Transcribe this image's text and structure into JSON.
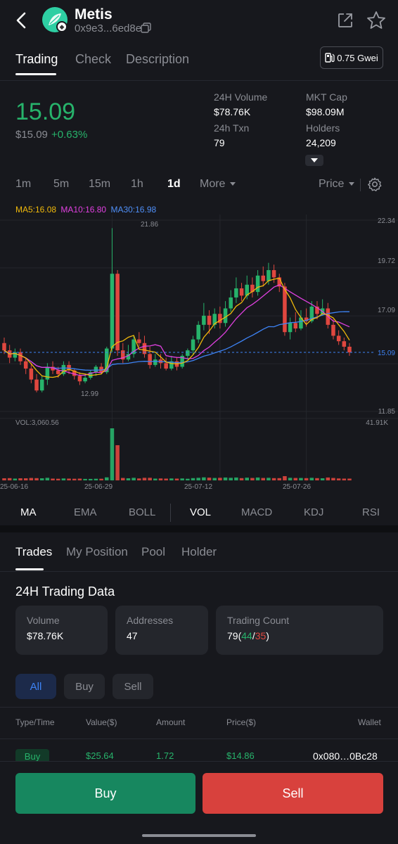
{
  "header": {
    "coin_name": "Metis",
    "address": "0x9e3...6ed8e",
    "icons": [
      "back-arrow-icon",
      "coin-logo",
      "ethereum-icon",
      "copy-icon",
      "share-icon",
      "star-icon"
    ]
  },
  "tabs": [
    {
      "label": "Trading",
      "active": true
    },
    {
      "label": "Check",
      "active": false
    },
    {
      "label": "Description",
      "active": false
    }
  ],
  "gas": {
    "value": "0.75 Gwei",
    "icon": "gas-pump-icon"
  },
  "price": {
    "main": "15.09",
    "usd": "$15.09",
    "change": "+0.63%"
  },
  "stats": {
    "volume_label": "24H Volume",
    "volume_value": "$78.76K",
    "mktcap_label": "MKT Cap",
    "mktcap_value": "$98.09M",
    "txn_label": "24h Txn",
    "txn_value": "79",
    "holders_label": "Holders",
    "holders_value": "24,209"
  },
  "timeframes": [
    {
      "label": "1m",
      "active": false
    },
    {
      "label": "5m",
      "active": false
    },
    {
      "label": "15m",
      "active": false
    },
    {
      "label": "1h",
      "active": false
    },
    {
      "label": "1d",
      "active": true
    },
    {
      "label": "More",
      "active": false
    }
  ],
  "price_dropdown": "Price",
  "ma_legend": {
    "ma5": "MA5:16.08",
    "ma10": "MA10:16.80",
    "ma30": "MA30:16.98",
    "colors": {
      "ma5": "#f0b90b",
      "ma10": "#e040e0",
      "ma30": "#3d83f5"
    }
  },
  "chart_data": {
    "type": "candlestick",
    "y_ticks": [
      "22.34",
      "19.72",
      "17.09",
      "11.85"
    ],
    "current_price_tag": "15.09",
    "high_label": "21.86",
    "low_label": "12.99",
    "volume_label": "VOL:3,060.56",
    "volume_max_label": "41.91K",
    "x_ticks": [
      "25-06-16",
      "25-06-29",
      "25-07-12",
      "25-07-26"
    ],
    "candles": [
      [
        15.6,
        15.2,
        15.9,
        15.0
      ],
      [
        15.2,
        14.8,
        15.5,
        14.5
      ],
      [
        14.8,
        15.1,
        15.3,
        14.6
      ],
      [
        15.1,
        14.6,
        15.3,
        14.4
      ],
      [
        14.6,
        14.2,
        14.8,
        13.9
      ],
      [
        14.2,
        13.6,
        14.5,
        13.4
      ],
      [
        13.6,
        13.0,
        13.9,
        12.9
      ],
      [
        13.0,
        13.6,
        13.8,
        12.9
      ],
      [
        13.6,
        14.3,
        14.5,
        13.3
      ],
      [
        14.3,
        14.1,
        14.6,
        13.9
      ],
      [
        14.1,
        13.9,
        14.3,
        13.7
      ],
      [
        13.9,
        14.4,
        14.6,
        13.8
      ],
      [
        14.4,
        14.1,
        14.6,
        13.9
      ],
      [
        14.1,
        13.8,
        14.2,
        13.6
      ],
      [
        13.8,
        13.5,
        14.0,
        13.3
      ],
      [
        13.5,
        13.7,
        13.9,
        13.4
      ],
      [
        13.7,
        14.0,
        14.1,
        13.6
      ],
      [
        14.0,
        14.3,
        14.4,
        13.8
      ],
      [
        14.3,
        14.0,
        14.5,
        13.9
      ],
      [
        14.0,
        15.3,
        15.4,
        13.9
      ],
      [
        15.3,
        19.4,
        21.9,
        15.1
      ],
      [
        19.4,
        15.2,
        19.6,
        14.9
      ],
      [
        15.2,
        14.7,
        15.6,
        14.5
      ],
      [
        14.7,
        15.0,
        15.5,
        14.6
      ],
      [
        15.0,
        15.8,
        16.0,
        14.8
      ],
      [
        15.8,
        15.6,
        16.2,
        15.4
      ],
      [
        15.6,
        15.0,
        16.0,
        14.8
      ],
      [
        15.0,
        14.4,
        15.4,
        14.2
      ],
      [
        14.4,
        14.7,
        15.0,
        14.3
      ],
      [
        14.7,
        14.5,
        15.0,
        14.2
      ],
      [
        14.5,
        14.2,
        14.8,
        14.1
      ],
      [
        14.2,
        14.6,
        14.9,
        14.1
      ],
      [
        14.6,
        14.3,
        14.8,
        14.1
      ],
      [
        14.3,
        14.9,
        15.0,
        14.2
      ],
      [
        14.9,
        15.2,
        15.3,
        14.7
      ],
      [
        15.2,
        15.8,
        16.0,
        15.0
      ],
      [
        15.8,
        16.6,
        16.8,
        15.6
      ],
      [
        16.6,
        17.1,
        17.8,
        16.3
      ],
      [
        17.1,
        16.6,
        17.4,
        16.1
      ],
      [
        16.6,
        17.2,
        17.5,
        16.4
      ],
      [
        17.2,
        16.7,
        17.6,
        16.4
      ],
      [
        16.7,
        17.5,
        17.9,
        16.5
      ],
      [
        17.5,
        18.1,
        18.5,
        17.3
      ],
      [
        18.1,
        18.6,
        19.2,
        17.8
      ],
      [
        18.6,
        18.2,
        18.9,
        17.9
      ],
      [
        18.2,
        18.8,
        19.3,
        18.0
      ],
      [
        18.8,
        18.4,
        19.2,
        18.1
      ],
      [
        18.4,
        19.3,
        19.6,
        18.2
      ],
      [
        19.3,
        19.0,
        19.8,
        18.7
      ],
      [
        19.0,
        19.6,
        20.0,
        18.8
      ],
      [
        19.6,
        19.2,
        19.9,
        18.9
      ],
      [
        19.2,
        18.7,
        19.4,
        18.4
      ],
      [
        18.7,
        16.2,
        18.9,
        16.0
      ],
      [
        16.2,
        16.7,
        17.0,
        15.8
      ],
      [
        16.7,
        16.4,
        17.3,
        16.2
      ],
      [
        16.4,
        17.0,
        17.4,
        16.3
      ],
      [
        17.0,
        16.8,
        17.5,
        16.5
      ],
      [
        16.8,
        17.6,
        17.9,
        16.7
      ],
      [
        17.6,
        17.2,
        17.9,
        16.9
      ],
      [
        17.2,
        17.5,
        18.0,
        17.1
      ],
      [
        17.5,
        16.6,
        17.8,
        16.4
      ],
      [
        16.6,
        16.0,
        16.9,
        15.8
      ],
      [
        16.0,
        15.7,
        16.3,
        15.5
      ],
      [
        15.7,
        15.4,
        15.9,
        15.2
      ],
      [
        15.4,
        15.09,
        15.6,
        14.9
      ]
    ]
  },
  "indicator_tabs": [
    {
      "label": "MA",
      "active": true
    },
    {
      "label": "EMA",
      "active": false
    },
    {
      "label": "BOLL",
      "active": false
    },
    {
      "label": "VOL",
      "active": true
    },
    {
      "label": "MACD",
      "active": false
    },
    {
      "label": "KDJ",
      "active": false
    },
    {
      "label": "RSI",
      "active": false
    }
  ],
  "trade_tabs": [
    {
      "label": "Trades",
      "active": true
    },
    {
      "label": "My Position",
      "active": false
    },
    {
      "label": "Pool",
      "active": false
    },
    {
      "label": "Holder",
      "active": false
    }
  ],
  "trading_data": {
    "title": "24H Trading Data",
    "volume_label": "Volume",
    "volume_value": "$78.76K",
    "addresses_label": "Addresses",
    "addresses_value": "47",
    "count_label": "Trading Count",
    "count_total": "79(",
    "count_buys": "44",
    "count_slash": "/",
    "count_sells": "35",
    "count_close": ")"
  },
  "filters": [
    {
      "label": "All",
      "active": true
    },
    {
      "label": "Buy",
      "active": false
    },
    {
      "label": "Sell",
      "active": false
    }
  ],
  "table": {
    "headers": [
      "Type/Time",
      "Value($)",
      "Amount",
      "Price($)",
      "Wallet"
    ],
    "rows": [
      {
        "type": "Buy",
        "value": "$25.64",
        "amount": "1.72",
        "price": "$14.86",
        "wallet": "0x080…0Bc28"
      }
    ]
  },
  "actions": {
    "buy": "Buy",
    "sell": "Sell"
  }
}
